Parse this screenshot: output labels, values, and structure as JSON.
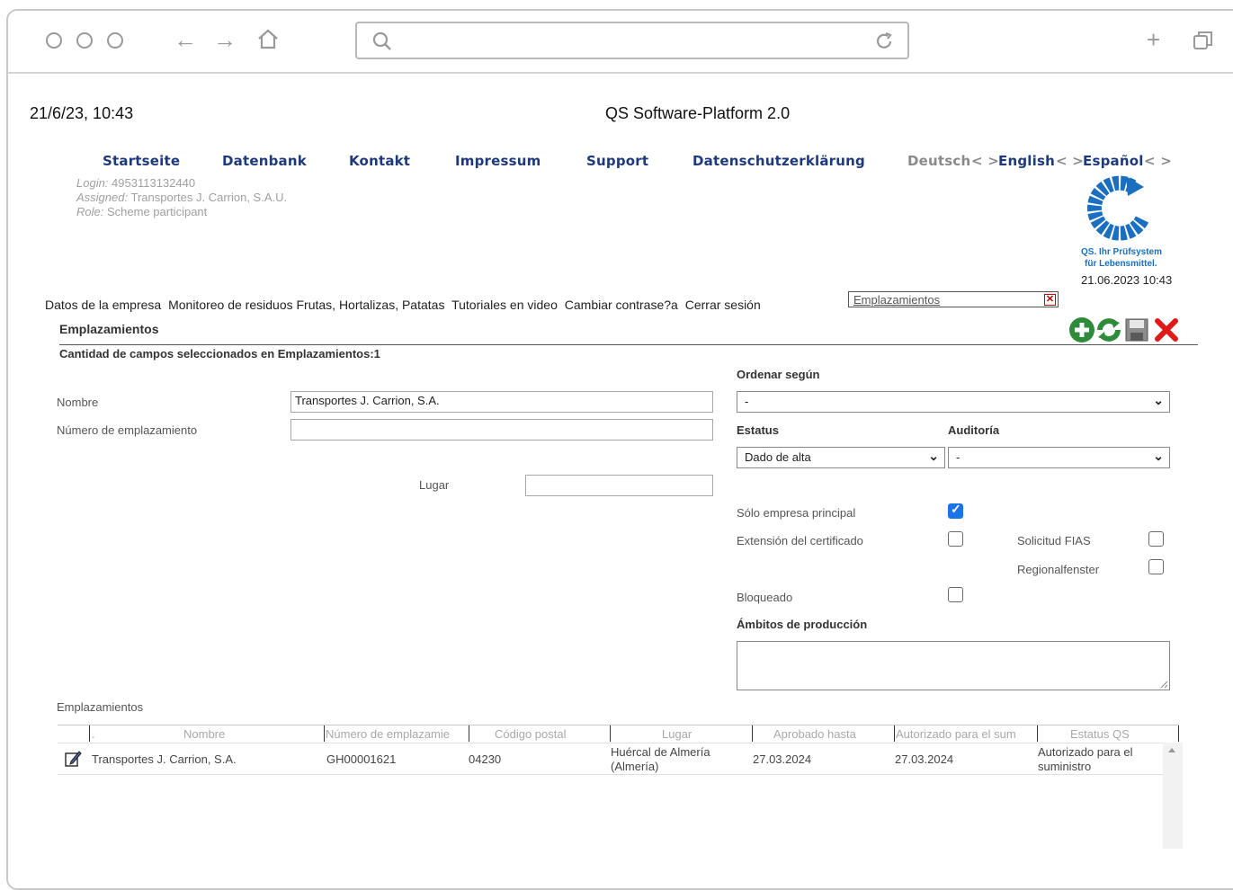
{
  "page": {
    "datetime": "21/6/23, 10:43",
    "title": "QS Software-Platform 2.0"
  },
  "nav": {
    "items": [
      "Startseite",
      "Datenbank",
      "Kontakt",
      "Impressum",
      "Support",
      "Datenschutzerklärung"
    ],
    "languages": {
      "deutsch": "Deutsch",
      "english": "English",
      "espanol": "Español",
      "separator": "< >"
    }
  },
  "user": {
    "login_label": "Login:",
    "login_value": "4953113132440",
    "assigned_label": "Assigned:",
    "assigned_value": "Transportes J. Carrion, S.A.U.",
    "role_label": "Role:",
    "role_value": "Scheme participant"
  },
  "logo": {
    "caption_line1": "QS. Ihr Prüfsystem",
    "caption_line2": "für Lebensmittel.",
    "timestamp": "21.06.2023 10:43",
    "brand_color": "#1a6fc0"
  },
  "menu": {
    "items": [
      "Datos de la empresa",
      "Monitoreo de residuos Frutas, Hortalizas, Patatas",
      "Tutoriales en video",
      "Cambiar contrase?a",
      "Cerrar sesión"
    ],
    "search_value": "Emplazamientos"
  },
  "section": {
    "title": "Emplazamientos",
    "count_text": "Cantidad de campos seleccionados en Emplazamientos:1"
  },
  "toolbar": {
    "add": "add-icon",
    "refresh": "refresh-icon",
    "save": "save-icon",
    "close": "close-icon"
  },
  "form": {
    "nombre_label": "Nombre",
    "nombre_value": "Transportes J. Carrion, S.A.",
    "numero_label": "Número de emplazamiento",
    "numero_value": "",
    "lugar_label": "Lugar",
    "lugar_value": "",
    "ordenar_label": "Ordenar según",
    "ordenar_value": "-",
    "estatus_label": "Estatus",
    "estatus_value": "Dado de alta",
    "auditoria_label": "Auditoría",
    "auditoria_value": "-",
    "solo_label": "Sólo empresa principal",
    "solo_checked": true,
    "extension_label": "Extensión del certificado",
    "extension_checked": false,
    "fias_label": "Solicitud FIAS",
    "fias_checked": false,
    "regional_label": "Regionalfenster",
    "regional_checked": false,
    "bloqueado_label": "Bloqueado",
    "bloqueado_checked": false,
    "ambitos_label": "Ámbitos de producción"
  },
  "table": {
    "title": "Emplazamientos",
    "columns": [
      ".",
      "Nombre",
      "Número de emplazamie",
      "Código postal",
      "Lugar",
      "Aprobado hasta",
      "Autorizado para el sum",
      "Estatus QS"
    ],
    "rows": [
      {
        "nombre": "Transportes J. Carrion, S.A.",
        "numero": "GH00001621",
        "codigo": "04230",
        "lugar": "Huércal de Almería (Almería)",
        "aprobado": "27.03.2024",
        "autorizado": "27.03.2024",
        "estatus": "Autorizado para el suministro"
      }
    ]
  }
}
